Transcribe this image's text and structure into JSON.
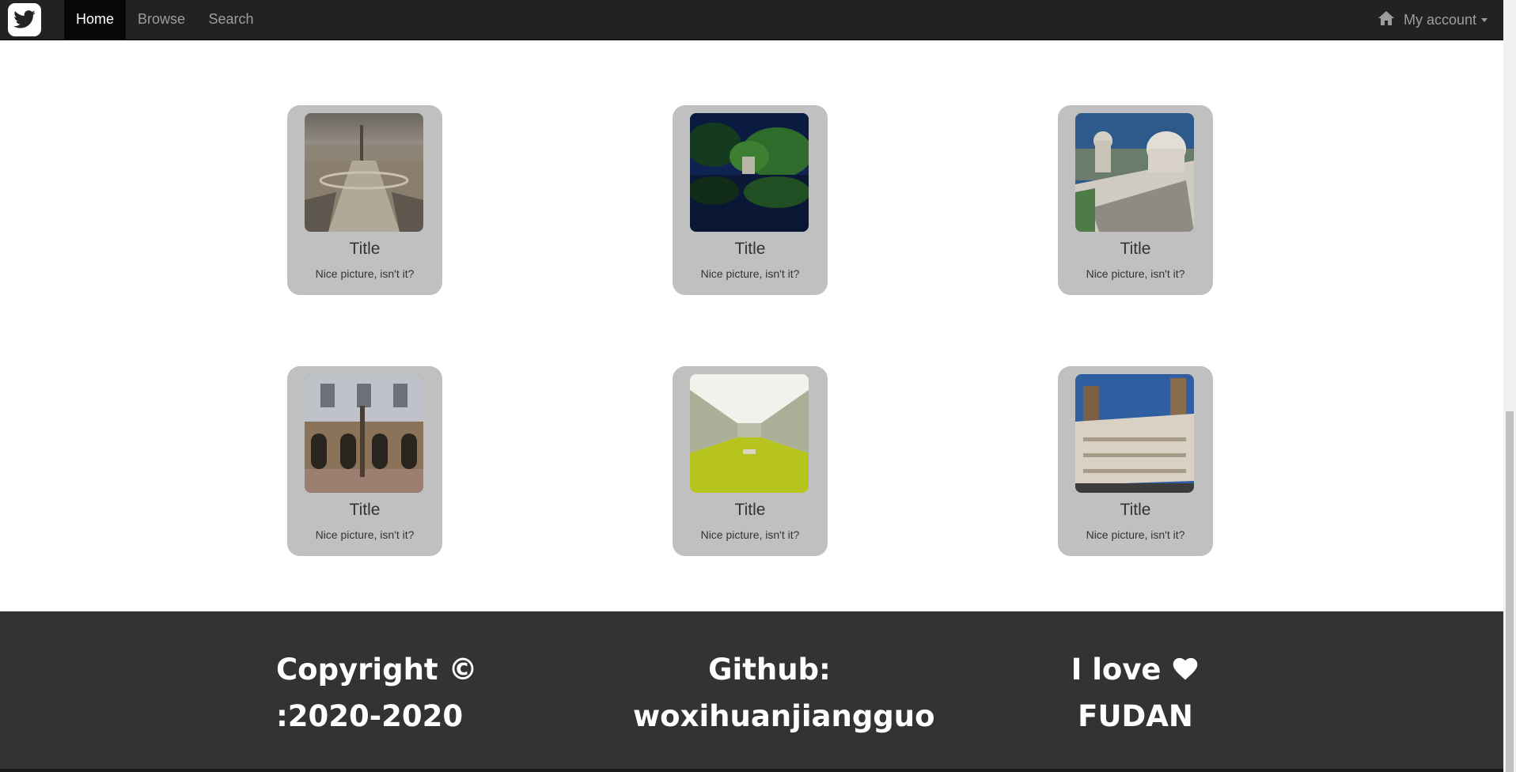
{
  "nav": {
    "logo_icon": "twitter-bird-icon",
    "items": [
      {
        "label": "Home",
        "active": true
      },
      {
        "label": "Browse",
        "active": false
      },
      {
        "label": "Search",
        "active": false
      }
    ],
    "account": {
      "icon": "home-icon",
      "label": "My account"
    }
  },
  "gallery": {
    "cards": [
      {
        "title": "Title",
        "caption": "Nice picture, isn't it?"
      },
      {
        "title": "Title",
        "caption": "Nice picture, isn't it?"
      },
      {
        "title": "Title",
        "caption": "Nice picture, isn't it?"
      },
      {
        "title": "Title",
        "caption": "Nice picture, isn't it?"
      },
      {
        "title": "Title",
        "caption": "Nice picture, isn't it?"
      },
      {
        "title": "Title",
        "caption": "Nice picture, isn't it?"
      }
    ]
  },
  "footer": {
    "copyright_line1": "Copyright ©",
    "copyright_line2": ":2020-2020",
    "github_line1": "Github:",
    "github_line2": "woxihuanjiangguo",
    "love_line1": "I love",
    "love_icon": "heart-icon",
    "love_line2": "FUDAN"
  },
  "colors": {
    "navbar_bg": "#222222",
    "nav_active_bg": "#080808",
    "card_bg": "#c0c0c0",
    "footer_bg": "#333333"
  }
}
